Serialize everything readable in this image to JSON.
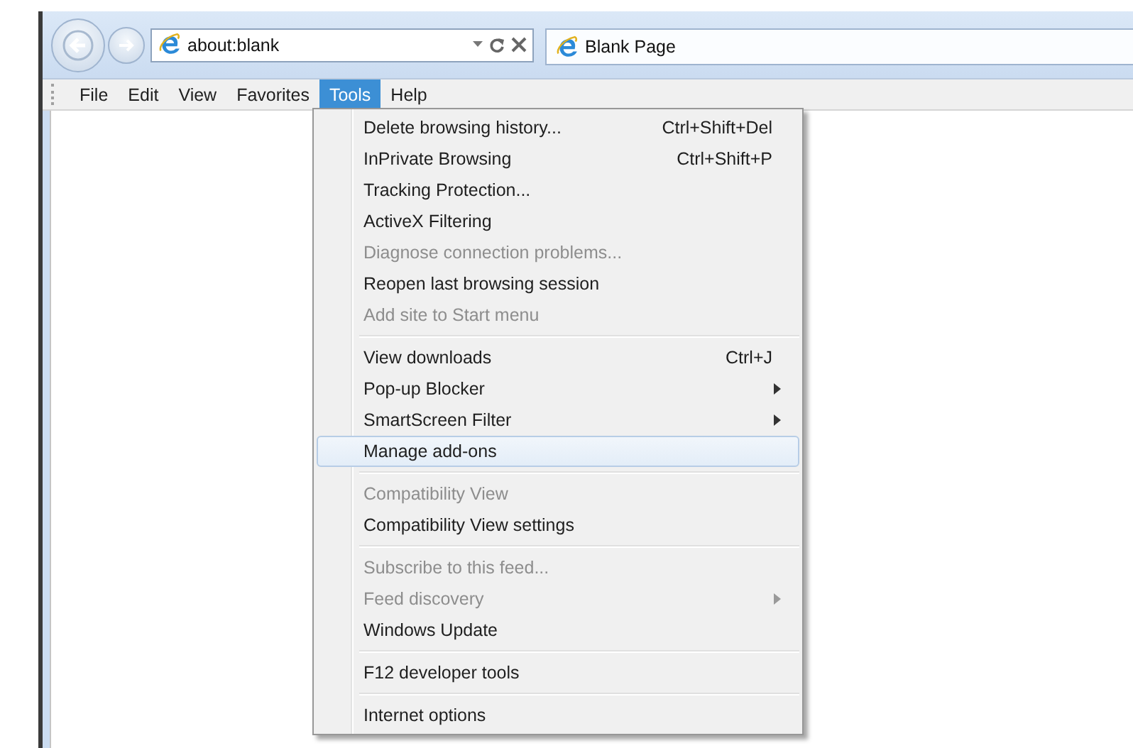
{
  "address_bar": {
    "value": "about:blank"
  },
  "tab": {
    "title": "Blank Page"
  },
  "menu_bar": [
    {
      "label": "File",
      "selected": false
    },
    {
      "label": "Edit",
      "selected": false
    },
    {
      "label": "View",
      "selected": false
    },
    {
      "label": "Favorites",
      "selected": false
    },
    {
      "label": "Tools",
      "selected": true
    },
    {
      "label": "Help",
      "selected": false
    }
  ],
  "tools_menu": {
    "groups": [
      {
        "items": [
          {
            "label": "Delete browsing history...",
            "shortcut": "Ctrl+Shift+Del",
            "disabled": false,
            "submenu": false,
            "selected": false
          },
          {
            "label": "InPrivate Browsing",
            "shortcut": "Ctrl+Shift+P",
            "disabled": false,
            "submenu": false,
            "selected": false
          },
          {
            "label": "Tracking Protection...",
            "disabled": false,
            "submenu": false,
            "selected": false
          },
          {
            "label": "ActiveX Filtering",
            "disabled": false,
            "submenu": false,
            "selected": false
          },
          {
            "label": "Diagnose connection problems...",
            "disabled": true,
            "submenu": false,
            "selected": false
          },
          {
            "label": "Reopen last browsing session",
            "disabled": false,
            "submenu": false,
            "selected": false
          },
          {
            "label": "Add site to Start menu",
            "disabled": true,
            "submenu": false,
            "selected": false
          }
        ]
      },
      {
        "items": [
          {
            "label": "View downloads",
            "shortcut": "Ctrl+J",
            "disabled": false,
            "submenu": false,
            "selected": false
          },
          {
            "label": "Pop-up Blocker",
            "disabled": false,
            "submenu": true,
            "selected": false
          },
          {
            "label": "SmartScreen Filter",
            "disabled": false,
            "submenu": true,
            "selected": false
          },
          {
            "label": "Manage add-ons",
            "disabled": false,
            "submenu": false,
            "selected": true
          }
        ]
      },
      {
        "items": [
          {
            "label": "Compatibility View",
            "disabled": true,
            "submenu": false,
            "selected": false
          },
          {
            "label": "Compatibility View settings",
            "disabled": false,
            "submenu": false,
            "selected": false
          }
        ]
      },
      {
        "items": [
          {
            "label": "Subscribe to this feed...",
            "disabled": true,
            "submenu": false,
            "selected": false
          },
          {
            "label": "Feed discovery",
            "disabled": true,
            "submenu": true,
            "selected": false
          },
          {
            "label": "Windows Update",
            "disabled": false,
            "submenu": false,
            "selected": false
          }
        ]
      },
      {
        "items": [
          {
            "label": "F12 developer tools",
            "disabled": false,
            "submenu": false,
            "selected": false
          }
        ]
      },
      {
        "items": [
          {
            "label": "Internet options",
            "disabled": false,
            "submenu": false,
            "selected": false
          }
        ]
      }
    ]
  }
}
